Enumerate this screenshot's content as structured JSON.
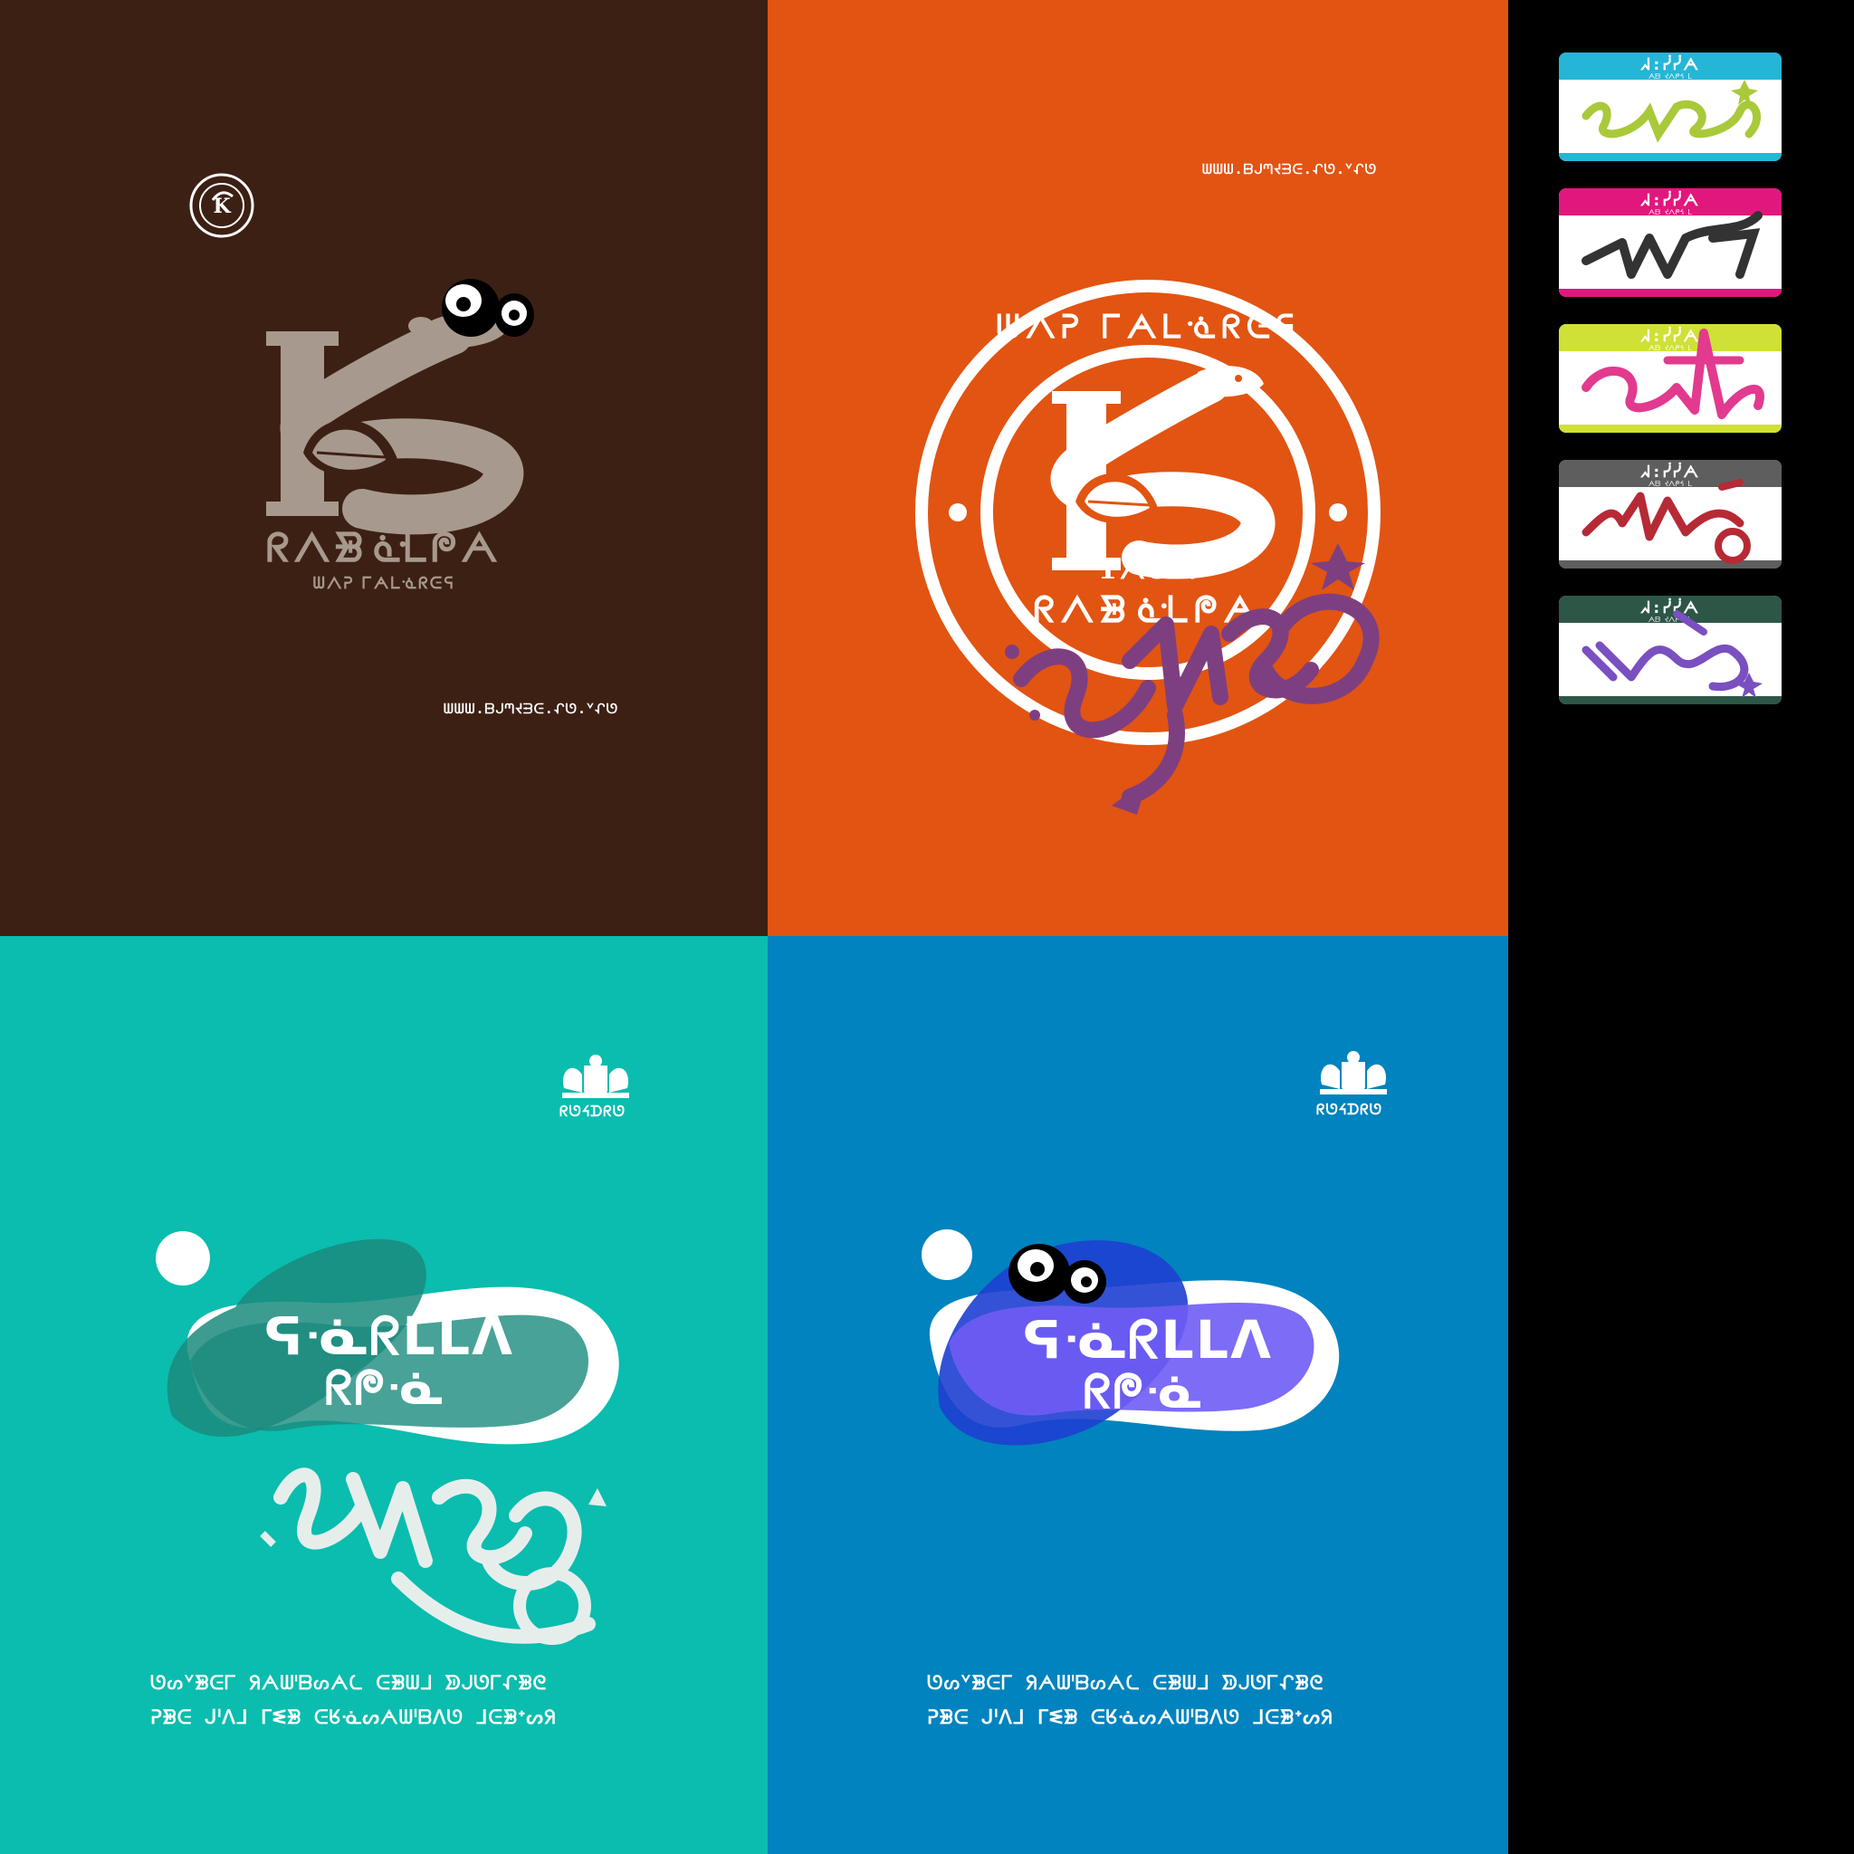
{
  "colors": {
    "brown_bg": "#3D2014",
    "orange_bg": "#E25412",
    "teal_bg": "#0ABDAE",
    "blue_bg": "#0083BE",
    "black_bg": "#000000",
    "emblem_grey": "#A7998E",
    "graffiti_purple": "#7E3F80",
    "blob_teal_dark": "#1A8B7D",
    "blob_violet": "#6F5CF5"
  },
  "panel_brown": {
    "brand_name": "ᖇᐱᗾᓎᒪᖘᗅ",
    "brand_sub": "ᗯᐱᕈ ᒥᗅᒪᓍᖇᕮᕋ",
    "url": "ᗯᗯᗯ.ᗹᒍᘉᔪᗳᕮ.ᖋᘎ.ᘁᖋᘎ"
  },
  "panel_orange": {
    "url": "ᗯᗯᗯ.ᗹᒍᘉᔪᗳᕮ.ᖋᘎ.ᘁᖋᘎ",
    "seal_top_text": "ᗯᐱᕈ ᒥᗅᒪᓍᖇᕮᕋ",
    "seal_bottom_text": "ᖇᐱᗾᓎᒪᖘᗅ",
    "seal_year": "1ᗅ8ᗅ"
  },
  "panel_teal": {
    "crest_label": "ᖇᘎᔦᗪᖇᘎ",
    "logo_line1": "ᕋᓍᖇᒪᒪᐱ",
    "logo_line2": "ᖇᖘᓍ",
    "body_line1": "ᘎᔕᘁᗾᕮᒥ ᖆᗅᗯᑊᗹᔕᗅᘇ ᕮᗾᗯᒧ ᗥᒍᘎᒥᖋᗾᘓ",
    "body_line2": "ᕈᗾᕮ ᒍᑊᐱᒧ ᒥᓬᗾ ᕮᖉᓍᔕᗅᗯᑊᗹᐱᘎ ᒧᕮᗾᐩᔕᖆ"
  },
  "panel_blue": {
    "crest_label": "ᖇᘎᔦᗪᖇᘎ",
    "logo_line1": "ᕋᓍᖇᒪᒪᐱ",
    "logo_line2": "ᖇᖘᓍ",
    "body_line1": "ᘎᔕᘁᗾᕮᒥ ᖆᗅᗯᑊᗹᔕᗅᘇ ᕮᗾᗯᒧ ᗥᒍᘎᒥᖋᗾᘓ",
    "body_line2": "ᕈᗾᕮ ᒍᑊᐱᒧ ᒥᓬᗾ ᕮᖉᓍᔕᗅᗯᑊᗹᐱᘎ ᒧᕮᗾᐩᔕᖆ"
  },
  "stickers": [
    {
      "header": "ᖽ:ᓰᓰᗅ",
      "sub": "ᗅᗷ ᔪᐱᖘᔦ ᒪ",
      "band": "#25B6D6",
      "ink": "#A9C93A"
    },
    {
      "header": "ᖽ:ᓰᓰᗅ",
      "sub": "ᗅᗷ ᔪᐱᖘᔦ ᒪ",
      "band": "#E2177E",
      "ink": "#333333"
    },
    {
      "header": "ᖽ:ᓰᓰᗅ",
      "sub": "ᗅᗷ ᔪᐱᖘᔦ ᒪ",
      "band": "#CFE037",
      "ink": "#E23A8E"
    },
    {
      "header": "ᖽ:ᓰᓰᗅ",
      "sub": "ᗅᗷ ᔪᐱᖘᔦ ᒪ",
      "band": "#5E5E5E",
      "ink": "#B62A36"
    },
    {
      "header": "ᖽ:ᓰᓰᗅ",
      "sub": "ᗅᗷ ᔪᐱᖘᔦ ᒪ",
      "band": "#2D5647",
      "ink": "#7A4FC0"
    }
  ]
}
